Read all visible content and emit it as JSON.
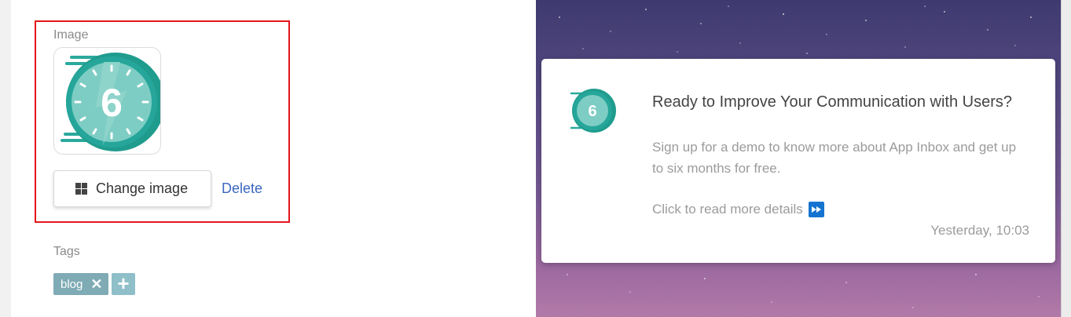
{
  "editor": {
    "image_label": "Image",
    "change_image_label": "Change image",
    "delete_label": "Delete",
    "tags_label": "Tags",
    "tags": [
      {
        "text": "blog",
        "remove_glyph": "✕"
      }
    ],
    "add_tag_glyph": "+",
    "image_number": "6"
  },
  "preview": {
    "icon_number": "6",
    "title": "Ready to Improve Your Communication with Users?",
    "body": "Sign up for a demo to know more about App Inbox and get up to six months for free.",
    "cta": "Click to read more details",
    "cta_icon": "fast-forward-icon",
    "timestamp": "Yesterday, 10:03"
  },
  "colors": {
    "highlight": "#e3161b",
    "link": "#3a66c1",
    "tag": "#7fabb5",
    "teal": "#26a69a",
    "cta_icon": "#1674d1"
  }
}
